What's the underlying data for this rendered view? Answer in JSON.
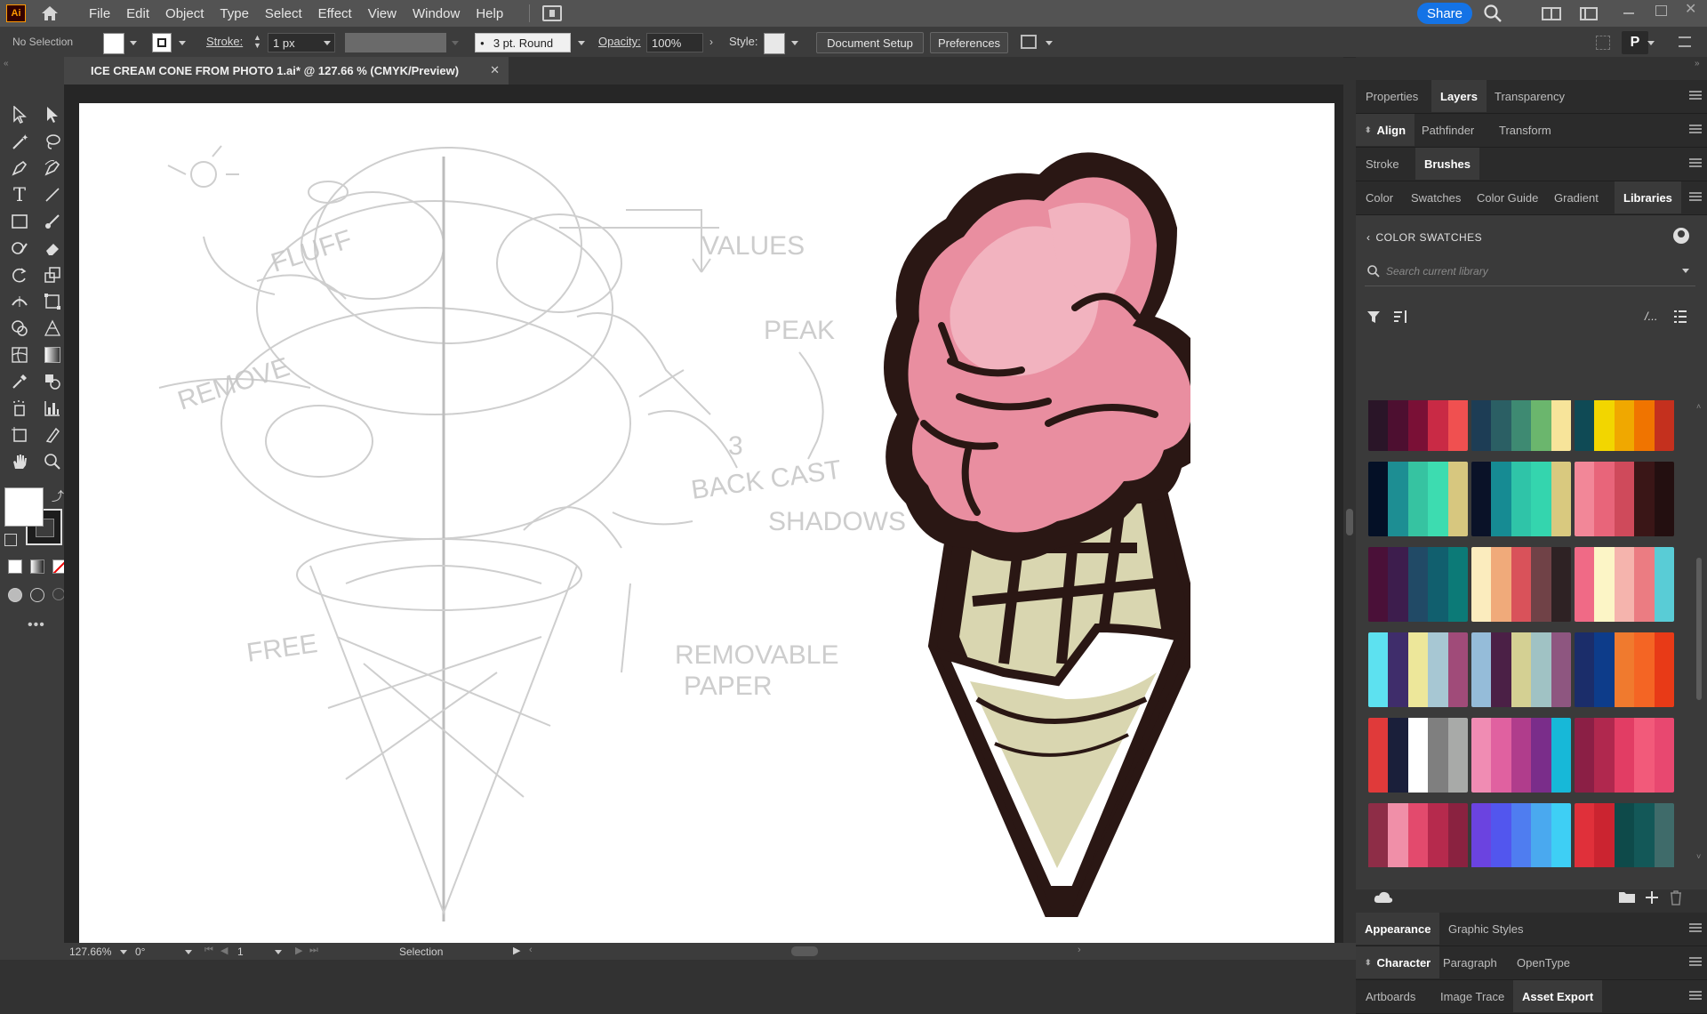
{
  "app": {
    "logo_text": "Ai"
  },
  "menubar": {
    "items": [
      "File",
      "Edit",
      "Object",
      "Type",
      "Select",
      "Effect",
      "View",
      "Window",
      "Help"
    ],
    "share_label": "Share"
  },
  "controlbar": {
    "selection_status": "No Selection",
    "stroke_label": "Stroke:",
    "stroke_value": "1 px",
    "brush_value": "3 pt. Round",
    "opacity_label": "Opacity:",
    "opacity_value": "100%",
    "style_label": "Style:",
    "document_setup_label": "Document Setup",
    "preferences_label": "Preferences"
  },
  "document": {
    "tab_title": "ICE CREAM CONE FROM PHOTO 1.ai* @ 127.66 % (CMYK/Preview)"
  },
  "statusbar": {
    "zoom": "127.66%",
    "rotation": "0°",
    "artboard": "1",
    "tool": "Selection"
  },
  "panel": {
    "row1": [
      "Properties",
      "Layers",
      "Transparency"
    ],
    "row1_active": "Layers",
    "row2": [
      "Align",
      "Pathfinder",
      "Transform"
    ],
    "row2_active": "Align",
    "row3": [
      "Stroke",
      "Brushes"
    ],
    "row3_active": "Brushes",
    "row4": [
      "Color",
      "Swatches",
      "Color Guide",
      "Gradient",
      "Libraries"
    ],
    "row4_active": "Libraries",
    "library_title": "COLOR SWATCHES",
    "search_placeholder": "Search current library",
    "swatch_groups": [
      [
        "#2a1528",
        "#4d0f30",
        "#7a1036",
        "#c92a45",
        "#f05050"
      ],
      [
        "#1d3d55",
        "#2b5f64",
        "#3e8a72",
        "#6bb66d",
        "#f7e49a"
      ],
      [
        "#0f4a55",
        "#f2d600",
        "#f0a800",
        "#f07400",
        "#c4301e"
      ],
      [
        "#041026",
        "#1d8e93",
        "#36c3a1",
        "#3ddcb0",
        "#d7c77f"
      ],
      [
        "#0a1228",
        "#168b93",
        "#2fc4a8",
        "#34d5ae",
        "#d9c97f"
      ],
      [
        "#f28798",
        "#e8657a",
        "#cf4a5b",
        "#3a1617",
        "#230f10"
      ],
      [
        "#4a1038",
        "#3d1d4d",
        "#214a66",
        "#115f6e",
        "#0c7a77"
      ],
      [
        "#fbecbe",
        "#f0aa7a",
        "#d9525a",
        "#704247",
        "#2e2224"
      ],
      [
        "#f06a86",
        "#fcf5c6",
        "#f5b4ad",
        "#eb7c82",
        "#59ccd6"
      ],
      [
        "#5de1f0",
        "#3f2d6b",
        "#ede79a",
        "#a7c7d3",
        "#a04b79"
      ],
      [
        "#95bcd9",
        "#4b2046",
        "#d4d093",
        "#a0c2c4",
        "#8e5680"
      ],
      [
        "#1b2d6a",
        "#0d3c8a",
        "#f07a2e",
        "#f46524",
        "#e83a17"
      ],
      [
        "#e03a3a",
        "#1a1f3a",
        "#ffffff",
        "#7f7f7f",
        "#a8aaa8"
      ],
      [
        "#f08cb3",
        "#e061a0",
        "#b03d8c",
        "#7a2d8a",
        "#17b8d8"
      ],
      [
        "#8b1f45",
        "#b0284e",
        "#e23d64",
        "#f25a7a",
        "#e84870"
      ],
      [
        "#8e2d47",
        "#f08fa8",
        "#e34a6d",
        "#b62a4d",
        "#8a2240"
      ],
      [
        "#6b43e0",
        "#5256ee",
        "#4f7df0",
        "#4aa9ef",
        "#3ecff5"
      ],
      [
        "#e0303a",
        "#cb2430",
        "#0e4a4a",
        "#135858",
        "#3f6b6a"
      ]
    ],
    "row_appearance": [
      "Appearance",
      "Graphic Styles"
    ],
    "row_appearance_active": "Appearance",
    "row_character": [
      "Character",
      "Paragraph",
      "OpenType"
    ],
    "row_character_active": "Character",
    "row_artboards": [
      "Artboards",
      "Image Trace",
      "Asset Export"
    ],
    "row_artboards_active": "Asset Export"
  },
  "sketch_notes": [
    "FLUFF",
    "REMOVE",
    "VALUES",
    "PEAK",
    "3",
    "BACK CAST",
    "SHADOWS",
    "FREE",
    "REMOVABLE",
    "PAPER"
  ]
}
